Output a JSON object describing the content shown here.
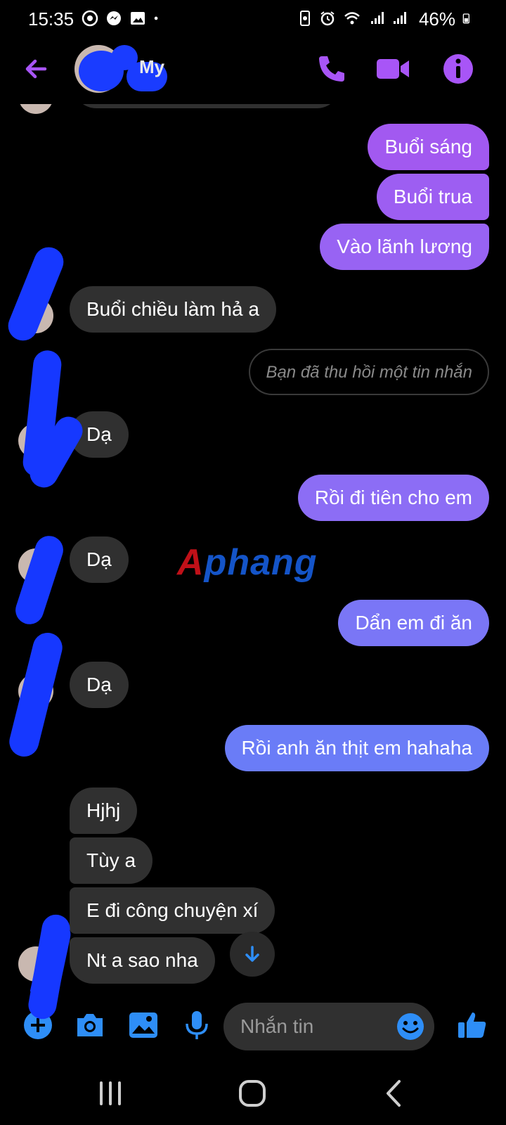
{
  "status_bar": {
    "time": "15:35",
    "battery": "46%"
  },
  "header": {
    "contact_name": "My"
  },
  "messages": {
    "m1": "Buổi sáng",
    "m2": "Buổi trua",
    "m3": "Vào lãnh lương",
    "m4": "Buổi chiều làm hả a",
    "m5": "Bạn đã thu hồi một tin nhắn",
    "m6": "Dạ",
    "m7": "Rồi đi tiên cho em",
    "m8": "Dạ",
    "m9": "Dẩn em đi ăn",
    "m10": "Dạ",
    "m11": "Rồi anh ăn thịt em hahaha",
    "m12": "Hjhj",
    "m13": "Tùy a",
    "m14": "E đi công chuyện xí",
    "m15": "Nt a sao nha"
  },
  "watermark": {
    "part1": "A",
    "part2": "phang"
  },
  "composer": {
    "placeholder": "Nhắn tin"
  },
  "colors": {
    "accent": "#a855f7",
    "outgoing_top": "#a259f0",
    "outgoing_mid": "#8f6cf5",
    "outgoing_bottom": "#6a7cf7",
    "incoming": "#303030",
    "composer_icons": "#2e8ef7"
  },
  "icons": {
    "header": [
      "back-arrow-icon",
      "phone-icon",
      "video-camera-icon",
      "info-icon"
    ],
    "composer": [
      "plus-icon",
      "camera-icon",
      "image-icon",
      "microphone-icon",
      "emoji-icon",
      "like-thumb-icon"
    ],
    "nav": [
      "recent-apps-icon",
      "home-icon",
      "back-icon"
    ]
  }
}
